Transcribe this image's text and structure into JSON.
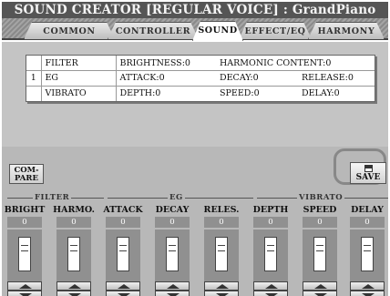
{
  "title": "SOUND CREATOR [REGULAR VOICE] : GrandPiano",
  "tabs": [
    {
      "label": "COMMON",
      "active": false
    },
    {
      "label": "CONTROLLER",
      "active": false
    },
    {
      "label": "SOUND",
      "active": true
    },
    {
      "label": "EFFECT/EQ",
      "active": false
    },
    {
      "label": "HARMONY",
      "active": false
    }
  ],
  "param_table": {
    "rows": [
      {
        "num": "",
        "name": "FILTER",
        "c1": "BRIGHTNESS:0",
        "c2": "HARMONIC CONTENT:0",
        "c3": ""
      },
      {
        "num": "1",
        "name": "EG",
        "c1": "ATTACK:0",
        "c2": "DECAY:0",
        "c3": "RELEASE:0"
      },
      {
        "num": "",
        "name": "VIBRATO",
        "c1": "DEPTH:0",
        "c2": "SPEED:0",
        "c3": "DELAY:0"
      }
    ]
  },
  "compare_label": "COM-\nPARE",
  "save_label": "SAVE",
  "groups": {
    "filter": "FILTER",
    "eg": "EG",
    "vibrato": "VIBRATO"
  },
  "sliders": [
    {
      "label": "BRIGHT",
      "value": "0"
    },
    {
      "label": "HARMO.",
      "value": "0"
    },
    {
      "label": "ATTACK",
      "value": "0"
    },
    {
      "label": "DECAY",
      "value": "0"
    },
    {
      "label": "RELES.",
      "value": "0"
    },
    {
      "label": "DEPTH",
      "value": "0"
    },
    {
      "label": "SPEED",
      "value": "0"
    },
    {
      "label": "DELAY",
      "value": "0"
    }
  ]
}
